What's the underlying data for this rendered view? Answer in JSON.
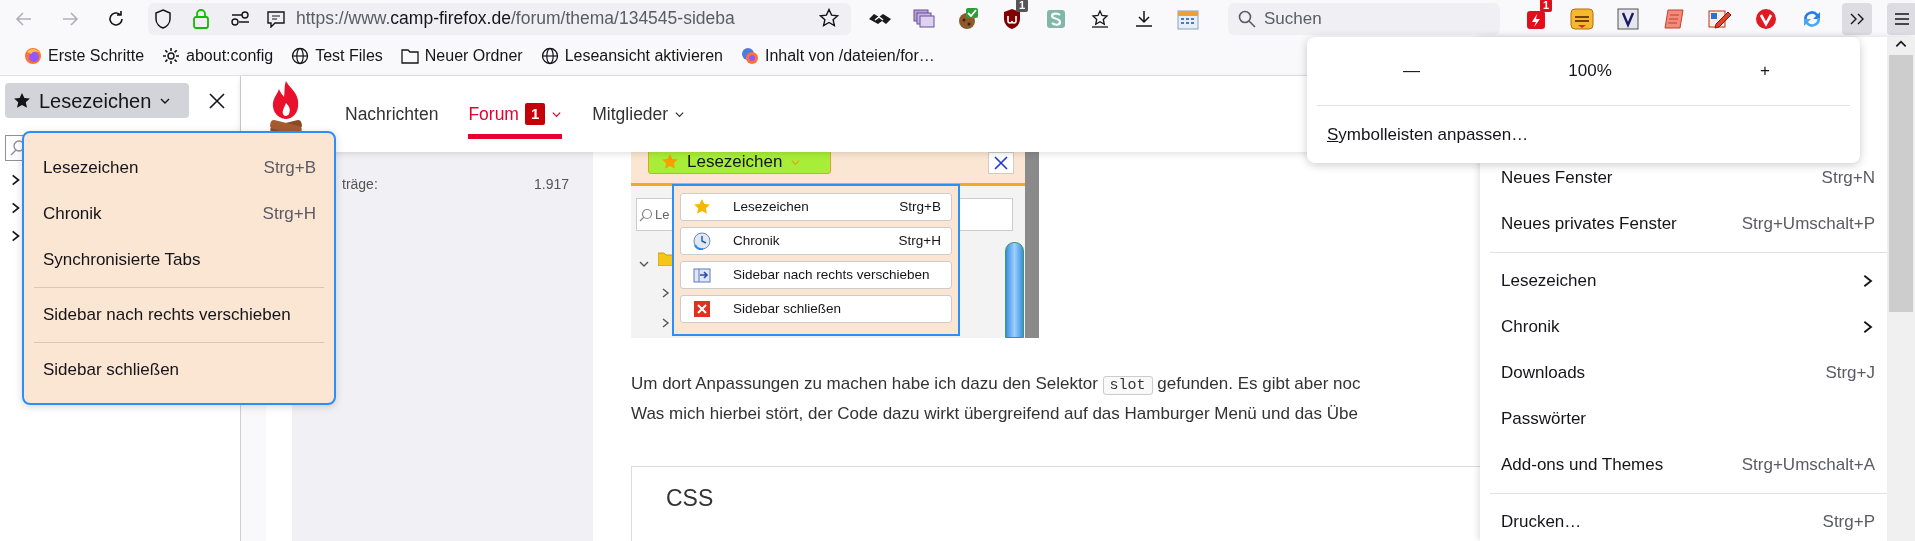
{
  "toolbar": {
    "url": {
      "scheme": "https://www.",
      "host": "camp-firefox.de",
      "path": "/forum/thema/134545-sideba"
    },
    "search": {
      "placeholder": "Suchen"
    },
    "extension_badges": [
      "1",
      "1"
    ]
  },
  "bookmarks_bar": [
    {
      "kind": "firefox",
      "label": "Erste Schritte"
    },
    {
      "kind": "gear",
      "label": "about:config"
    },
    {
      "kind": "globe",
      "label": "Test Files"
    },
    {
      "kind": "folder",
      "label": "Neuer Ordner"
    },
    {
      "kind": "globe",
      "label": "Leseansicht aktivieren"
    },
    {
      "kind": "site",
      "label": "Inhalt von /dateien/for…"
    }
  ],
  "sidebar": {
    "title": "Lesezeichen",
    "tree": [
      {
        "expanded": false
      },
      {
        "expanded": false
      },
      {
        "expanded": false
      }
    ]
  },
  "sidebar_menu": [
    {
      "kind": "item",
      "label": "Lesezeichen",
      "shortcut": "Strg+B"
    },
    {
      "kind": "item",
      "label": "Chronik",
      "shortcut": "Strg+H"
    },
    {
      "kind": "item",
      "label": "Synchronisierte Tabs"
    },
    {
      "kind": "separator"
    },
    {
      "kind": "item",
      "label": "Sidebar nach rechts verschieben"
    },
    {
      "kind": "separator"
    },
    {
      "kind": "item",
      "label": "Sidebar schließen"
    }
  ],
  "site_nav": [
    {
      "label": "Nachrichten",
      "selected": false,
      "dropdown": false
    },
    {
      "label": "Forum",
      "selected": true,
      "badge": "1",
      "dropdown": true
    },
    {
      "label": "Mitglieder",
      "selected": false,
      "dropdown": true
    }
  ],
  "stats": {
    "label": "träge:",
    "value": "1.917"
  },
  "post": {
    "screenshot": {
      "title": "Lesezeichen",
      "search_placeholder": "Le",
      "tree": [
        {
          "expanded": true
        },
        {
          "expanded": false
        },
        {
          "expanded": false
        }
      ],
      "menu": [
        {
          "kind": "star",
          "label": "Lesezeichen",
          "shortcut": "Strg+B"
        },
        {
          "kind": "clock",
          "label": "Chronik",
          "shortcut": "Strg+H"
        },
        {
          "kind": "move",
          "label": "Sidebar nach rechts verschieben"
        },
        {
          "kind": "close",
          "label": "Sidebar schließen"
        }
      ]
    },
    "paragraphs": [
      [
        {
          "text": "Um dort Anpassungen zu machen habe ich dazu den Selektor "
        },
        {
          "code": "slot"
        },
        {
          "text": " gefunden. Es gibt aber noc"
        }
      ],
      [
        {
          "text": "Was mich hierbei stört, der Code dazu wirkt übergreifend auf das Hamburger Menü und das Übe"
        }
      ]
    ],
    "code_block": {
      "title": "CSS"
    }
  },
  "zoom_panel": {
    "minus": "—",
    "level": "100%",
    "plus": "+",
    "customize": "Symbolleisten anpassen…"
  },
  "app_menu": [
    {
      "kind": "item",
      "label": "Neues Fenster",
      "shortcut": "Strg+N"
    },
    {
      "kind": "item",
      "label": "Neues privates Fenster",
      "shortcut": "Strg+Umschalt+P"
    },
    {
      "kind": "separator"
    },
    {
      "kind": "submenu",
      "label": "Lesezeichen"
    },
    {
      "kind": "submenu",
      "label": "Chronik"
    },
    {
      "kind": "item",
      "label": "Downloads",
      "shortcut": "Strg+J"
    },
    {
      "kind": "item",
      "label": "Passwörter"
    },
    {
      "kind": "item",
      "label": "Add-ons und Themes",
      "shortcut": "Strg+Umschalt+A"
    },
    {
      "kind": "separator"
    },
    {
      "kind": "item",
      "label": "Drucken…",
      "shortcut": "Strg+P"
    }
  ]
}
